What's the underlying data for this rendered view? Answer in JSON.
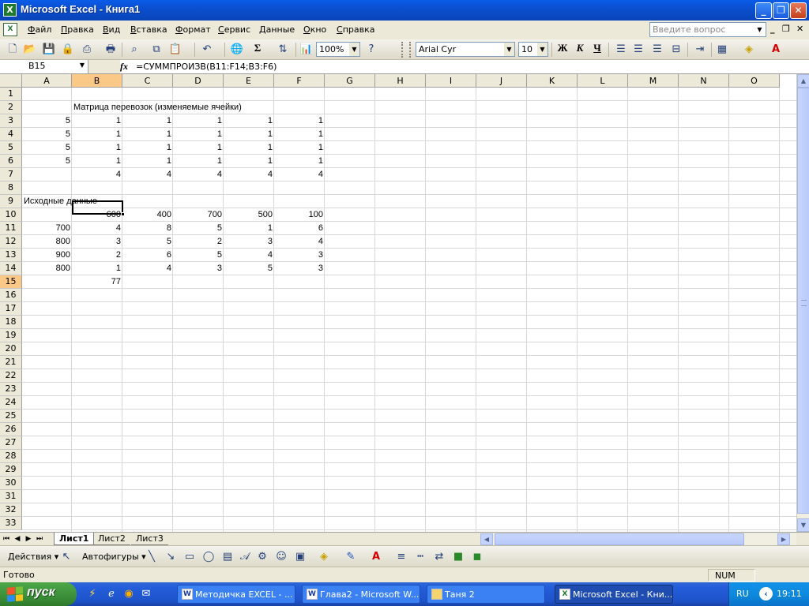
{
  "window": {
    "title": "Microsoft Excel - Книга1"
  },
  "menu": [
    "Файл",
    "Правка",
    "Вид",
    "Вставка",
    "Формат",
    "Сервис",
    "Данные",
    "Окно",
    "Справка"
  ],
  "ask_placeholder": "Введите вопрос",
  "toolbar": {
    "zoom": "100%",
    "font_name": "Arial Cyr",
    "font_size": "10",
    "bold": "Ж",
    "italic": "К",
    "underline": "Ч",
    "sigma": "Σ"
  },
  "formula_bar": {
    "cell_ref": "B15",
    "fx": "fx",
    "formula": "=СУММПРОИЗВ(B11:F14;B3:F6)"
  },
  "columns": [
    "A",
    "B",
    "C",
    "D",
    "E",
    "F",
    "G",
    "H",
    "I",
    "J",
    "K",
    "L",
    "M",
    "N",
    "O"
  ],
  "rows": [
    "1",
    "2",
    "3",
    "4",
    "5",
    "6",
    "7",
    "8",
    "9",
    "10",
    "11",
    "12",
    "13",
    "14",
    "15",
    "16",
    "17",
    "18",
    "19",
    "20",
    "21",
    "22",
    "23",
    "24",
    "25",
    "26",
    "27",
    "28",
    "29",
    "30",
    "31",
    "32",
    "33"
  ],
  "active_cell": {
    "col": "B",
    "row": "15"
  },
  "cells": {
    "B2": "Матрица перевозок (изменяемые ячейки)",
    "A3": "5",
    "B3": "1",
    "C3": "1",
    "D3": "1",
    "E3": "1",
    "F3": "1",
    "A4": "5",
    "B4": "1",
    "C4": "1",
    "D4": "1",
    "E4": "1",
    "F4": "1",
    "A5": "5",
    "B5": "1",
    "C5": "1",
    "D5": "1",
    "E5": "1",
    "F5": "1",
    "A6": "5",
    "B6": "1",
    "C6": "1",
    "D6": "1",
    "E6": "1",
    "F6": "1",
    "B7": "4",
    "C7": "4",
    "D7": "4",
    "E7": "4",
    "F7": "4",
    "A9": "Исходные данные",
    "B10": "600",
    "C10": "400",
    "D10": "700",
    "E10": "500",
    "F10": "100",
    "A11": "700",
    "B11": "4",
    "C11": "8",
    "D11": "5",
    "E11": "1",
    "F11": "6",
    "A12": "800",
    "B12": "3",
    "C12": "5",
    "D12": "2",
    "E12": "3",
    "F12": "4",
    "A13": "900",
    "B13": "2",
    "C13": "6",
    "D13": "5",
    "E13": "4",
    "F13": "3",
    "A14": "800",
    "B14": "1",
    "C14": "4",
    "D14": "3",
    "E14": "5",
    "F14": "3",
    "B15": "77"
  },
  "sheets": [
    "Лист1",
    "Лист2",
    "Лист3"
  ],
  "active_sheet": "Лист1",
  "drawing": {
    "actions": "Действия",
    "autoshapes": "Автофигуры"
  },
  "status": {
    "text": "Готово",
    "num": "NUM"
  },
  "taskbar": {
    "start": "пуск",
    "tasks": [
      "Методичка EXCEL - ...",
      "Глава2 - Microsoft W...",
      "Таня 2",
      "Microsoft Excel - Кни..."
    ],
    "lang": "RU",
    "clock": "19:11"
  }
}
